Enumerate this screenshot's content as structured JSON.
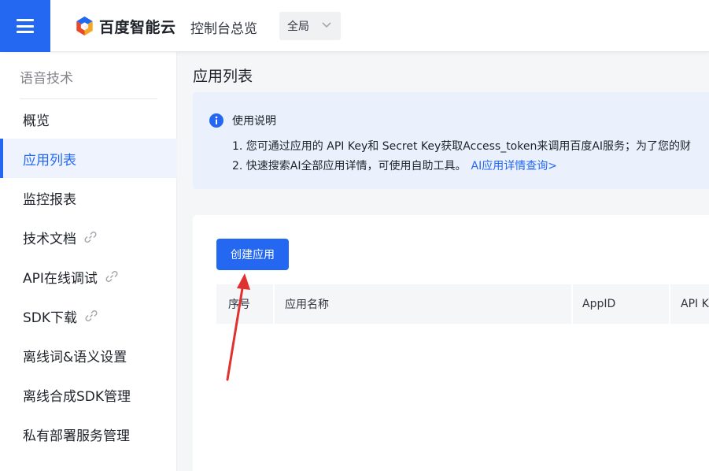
{
  "header": {
    "logo_text": "百度智能云",
    "console_title": "控制台总览",
    "region": "全局",
    "brand_color": "#2468f2"
  },
  "sidebar": {
    "section_title": "语音技术",
    "items": [
      {
        "label": "概览",
        "active": false,
        "external_link": false
      },
      {
        "label": "应用列表",
        "active": true,
        "external_link": false
      },
      {
        "label": "监控报表",
        "active": false,
        "external_link": false
      },
      {
        "label": "技术文档",
        "active": false,
        "external_link": true
      },
      {
        "label": "API在线调试",
        "active": false,
        "external_link": true
      },
      {
        "label": "SDK下载",
        "active": false,
        "external_link": true
      },
      {
        "label": "离线词&语义设置",
        "active": false,
        "external_link": false
      },
      {
        "label": "离线合成SDK管理",
        "active": false,
        "external_link": false
      },
      {
        "label": "私有部署服务管理",
        "active": false,
        "external_link": false
      }
    ]
  },
  "main": {
    "page_title": "应用列表",
    "notice": {
      "title": "使用说明",
      "line1": "1. 您可通过应用的 API Key和 Secret Key获取Access_token来调用百度AI服务；为了您的财",
      "line2": "2. 快速搜索AI全部应用详情，可使用自助工具。",
      "link": "AI应用详情查询>"
    },
    "create_button": "创建应用",
    "table": {
      "columns": [
        "序号",
        "应用名称",
        "AppID",
        "API Key"
      ]
    }
  },
  "annotation": {
    "arrow_color": "#e03131"
  }
}
